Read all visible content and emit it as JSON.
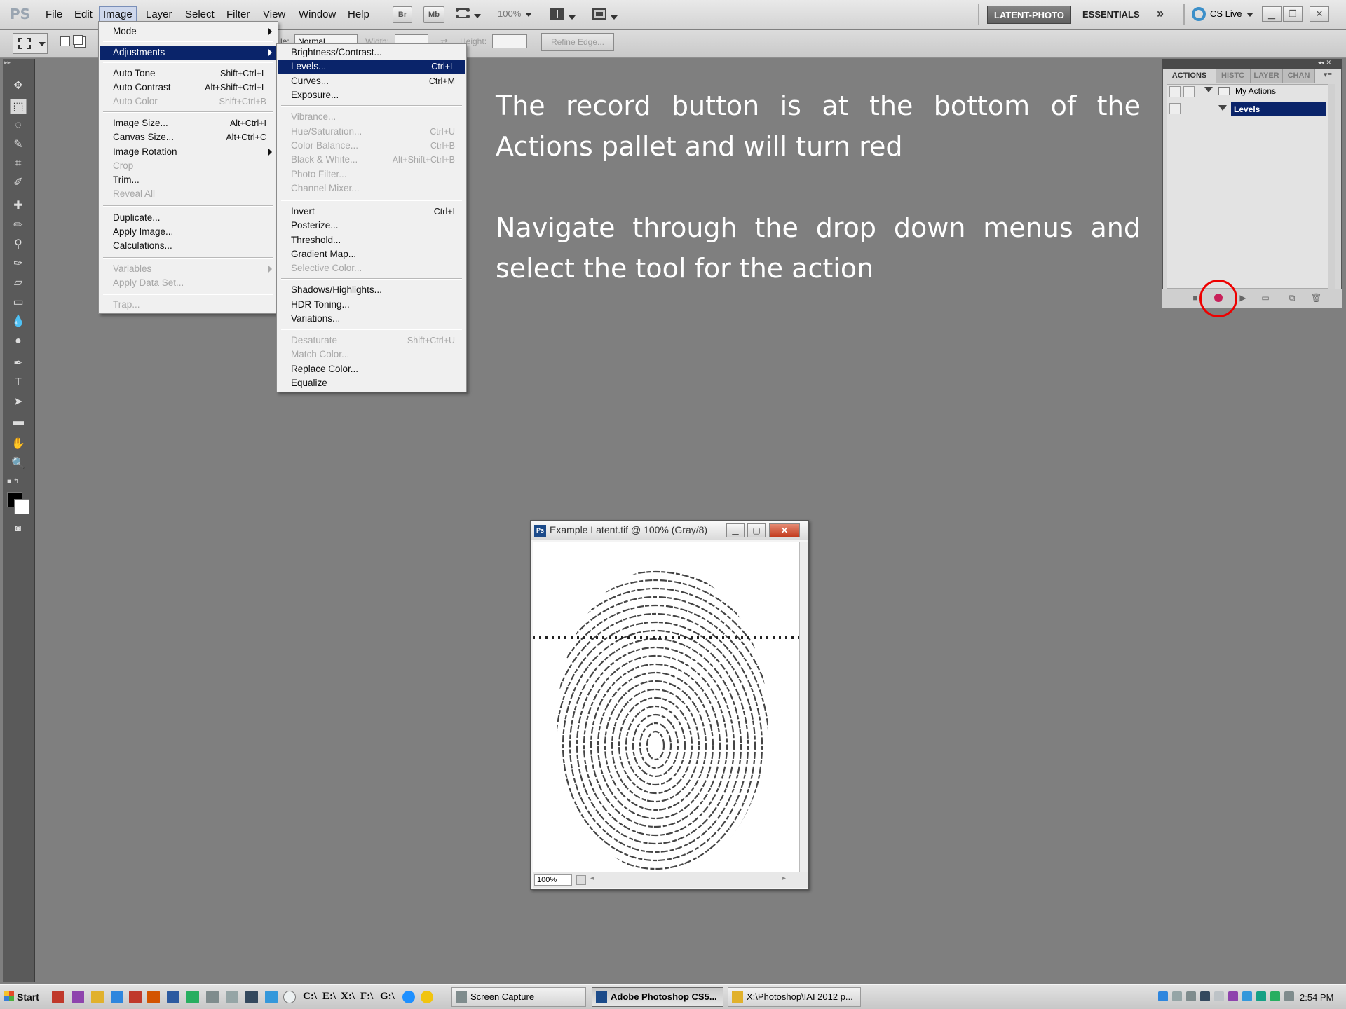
{
  "menubar": {
    "logo": "PS",
    "items": [
      "File",
      "Edit",
      "Image",
      "Layer",
      "Select",
      "Filter",
      "View",
      "Window",
      "Help"
    ],
    "active_item": "Image",
    "bridge_btn": "Br",
    "minibridge_btn": "Mb",
    "zoom": "100%",
    "workspaces": {
      "active": "LATENT-PHOTO",
      "other": "ESSENTIALS",
      "more": "»"
    },
    "cs_live": "CS Live"
  },
  "options_bar": {
    "style_label": "le:",
    "style_value": "Normal",
    "width_label": "Width:",
    "height_label": "Height:",
    "refine_edge": "Refine Edge..."
  },
  "image_menu": {
    "items": [
      {
        "label": "Mode",
        "submenu": true
      },
      {
        "label": "Adjustments",
        "submenu": true,
        "highlight": true
      },
      {
        "label": "Auto Tone",
        "shortcut": "Shift+Ctrl+L"
      },
      {
        "label": "Auto Contrast",
        "shortcut": "Alt+Shift+Ctrl+L"
      },
      {
        "label": "Auto Color",
        "shortcut": "Shift+Ctrl+B",
        "disabled": true
      },
      {
        "label": "Image Size...",
        "shortcut": "Alt+Ctrl+I"
      },
      {
        "label": "Canvas Size...",
        "shortcut": "Alt+Ctrl+C"
      },
      {
        "label": "Image Rotation",
        "submenu": true
      },
      {
        "label": "Crop",
        "disabled": true
      },
      {
        "label": "Trim..."
      },
      {
        "label": "Reveal All",
        "disabled": true
      },
      {
        "label": "Duplicate..."
      },
      {
        "label": "Apply Image..."
      },
      {
        "label": "Calculations..."
      },
      {
        "label": "Variables",
        "submenu": true,
        "disabled": true
      },
      {
        "label": "Apply Data Set...",
        "disabled": true
      },
      {
        "label": "Trap...",
        "disabled": true
      }
    ]
  },
  "adjustments_menu": {
    "items": [
      {
        "label": "Brightness/Contrast..."
      },
      {
        "label": "Levels...",
        "shortcut": "Ctrl+L",
        "highlight": true
      },
      {
        "label": "Curves...",
        "shortcut": "Ctrl+M"
      },
      {
        "label": "Exposure..."
      },
      {
        "label": "Vibrance...",
        "disabled": true
      },
      {
        "label": "Hue/Saturation...",
        "shortcut": "Ctrl+U",
        "disabled": true
      },
      {
        "label": "Color Balance...",
        "shortcut": "Ctrl+B",
        "disabled": true
      },
      {
        "label": "Black & White...",
        "shortcut": "Alt+Shift+Ctrl+B",
        "disabled": true
      },
      {
        "label": "Photo Filter...",
        "disabled": true
      },
      {
        "label": "Channel Mixer...",
        "disabled": true
      },
      {
        "label": "Invert",
        "shortcut": "Ctrl+I"
      },
      {
        "label": "Posterize..."
      },
      {
        "label": "Threshold..."
      },
      {
        "label": "Gradient Map..."
      },
      {
        "label": "Selective Color...",
        "disabled": true
      },
      {
        "label": "Shadows/Highlights..."
      },
      {
        "label": "HDR Toning..."
      },
      {
        "label": "Variations..."
      },
      {
        "label": "Desaturate",
        "shortcut": "Shift+Ctrl+U",
        "disabled": true
      },
      {
        "label": "Match Color...",
        "disabled": true
      },
      {
        "label": "Replace Color..."
      },
      {
        "label": "Equalize"
      }
    ]
  },
  "slide": {
    "paragraph1": "The record button is at the bottom of the Actions pallet and will turn red",
    "paragraph2": "Navigate through the drop down menus and select the tool for the action"
  },
  "actions_panel": {
    "tabs": [
      "ACTIONS",
      "HISTC",
      "LAYER",
      "CHAN"
    ],
    "set_name": "My Actions",
    "action_name": "Levels"
  },
  "document": {
    "title": "Example Latent.tif @ 100% (Gray/8)",
    "zoom": "100%",
    "app_badge": "Ps"
  },
  "taskbar": {
    "start": "Start",
    "drives": [
      "C:\\",
      "E:\\",
      "X:\\",
      "F:\\",
      "G:\\"
    ],
    "tasks": [
      {
        "label": "Screen Capture",
        "active": false
      },
      {
        "label": "Adobe Photoshop CS5...",
        "active": true
      },
      {
        "label": "X:\\Photoshop\\IAI 2012 p...",
        "active": false
      }
    ],
    "clock": "2:54 PM"
  },
  "colors": {
    "workspace_bg": "#7f7f7f",
    "menu_highlight": "#0a246a",
    "record_red": "#e00000",
    "record_dot": "#c8205a"
  }
}
